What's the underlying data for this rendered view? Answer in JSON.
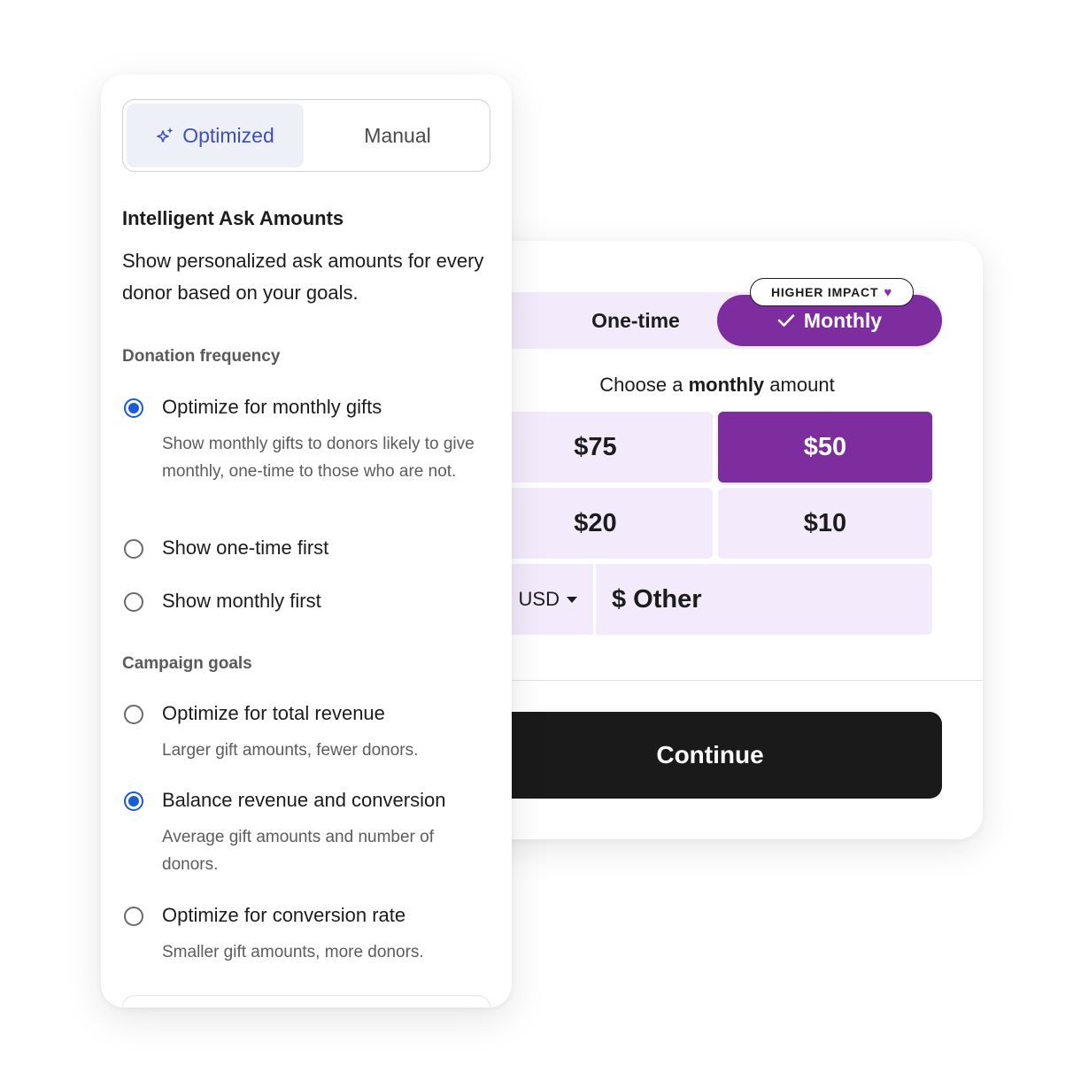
{
  "donation_card": {
    "frequency": {
      "one_time_label": "One-time",
      "monthly_label": "Monthly",
      "badge_label": "HIGHER IMPACT",
      "selected": "Monthly"
    },
    "choose_prefix": "Choose a",
    "choose_emphasis": "monthly",
    "choose_suffix": "amount",
    "amounts": [
      {
        "label": "$75",
        "selected": false
      },
      {
        "label": "$50",
        "selected": true
      },
      {
        "label": "$20",
        "selected": false
      },
      {
        "label": "$10",
        "selected": false
      }
    ],
    "currency": "USD",
    "other_label": "$ Other",
    "continue_label": "Continue",
    "accent_color": "#7d2d9e",
    "tint_color": "#f3eafb"
  },
  "settings": {
    "mode_toggle": {
      "optimized_label": "Optimized",
      "manual_label": "Manual",
      "selected": "Optimized"
    },
    "title": "Intelligent Ask Amounts",
    "description": "Show personalized ask amounts for every donor based on your goals.",
    "donation_frequency": {
      "label": "Donation frequency",
      "options": [
        {
          "label": "Optimize for monthly gifts",
          "help": "Show monthly gifts to donors likely to give monthly, one-time to those who are not.",
          "checked": true
        },
        {
          "label": "Show one-time first",
          "help": "",
          "checked": false
        },
        {
          "label": "Show monthly first",
          "help": "",
          "checked": false
        }
      ]
    },
    "campaign_goals": {
      "label": "Campaign goals",
      "options": [
        {
          "label": "Optimize for total revenue",
          "help": "Larger gift amounts, fewer donors.",
          "checked": false
        },
        {
          "label": "Balance revenue and conversion",
          "help": "Average gift amounts and number of donors.",
          "checked": true
        },
        {
          "label": "Optimize for conversion rate",
          "help": "Smaller gift amounts, more donors.",
          "checked": false
        }
      ]
    },
    "radio_color": "#1a5bd6"
  }
}
